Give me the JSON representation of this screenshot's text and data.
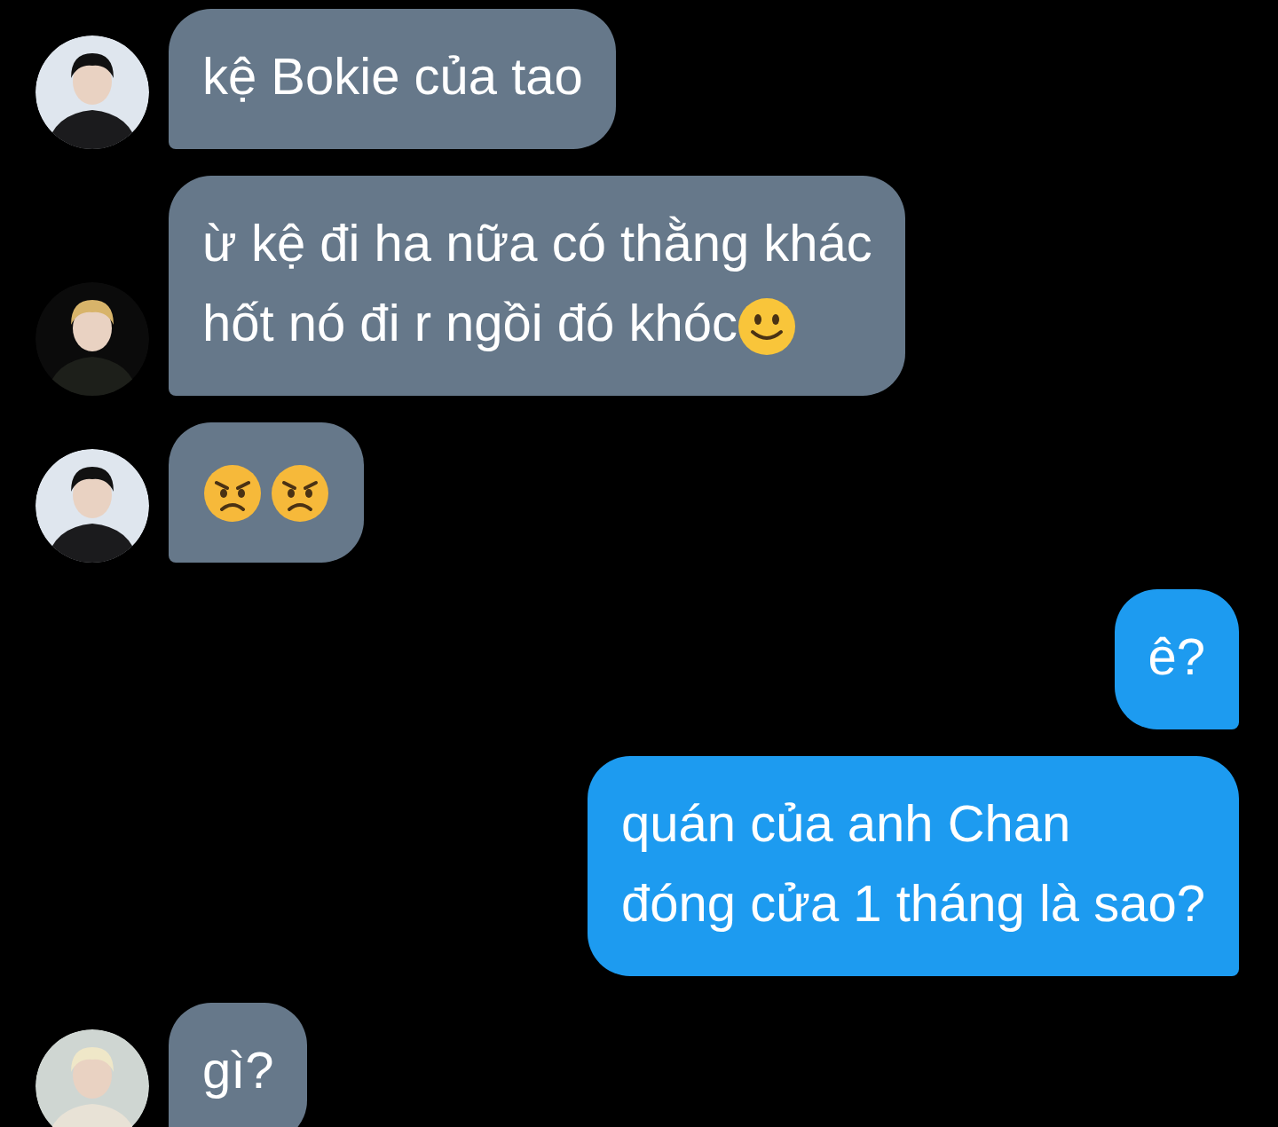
{
  "messages": [
    {
      "kind": "received",
      "avatar": {
        "kind": "dark"
      },
      "lines": [
        "kệ Bokie của tao"
      ]
    },
    {
      "kind": "received",
      "avatar": {
        "kind": "blond"
      },
      "lines": [
        "ừ kệ đi ha nữa có thằng khác",
        "hốt nó đi r ngồi đó khóc"
      ],
      "emojis": [
        {
          "kind": "smile"
        }
      ]
    },
    {
      "kind": "received",
      "avatar": {
        "kind": "dark"
      },
      "emojis": [
        {
          "kind": "angry"
        },
        {
          "kind": "angry"
        }
      ]
    },
    {
      "kind": "sent",
      "lines": [
        "ê?"
      ]
    },
    {
      "kind": "sent",
      "lines": [
        "quán của anh Chan",
        "đóng cửa 1 tháng là sao?"
      ]
    },
    {
      "kind": "received",
      "avatar": {
        "kind": "light"
      },
      "lines": [
        "gì?"
      ]
    }
  ]
}
